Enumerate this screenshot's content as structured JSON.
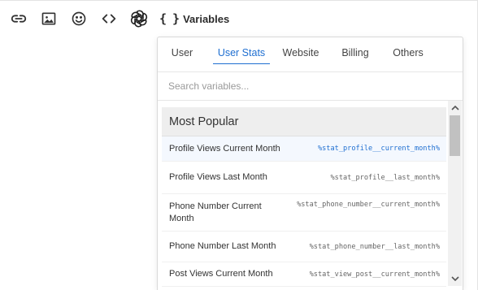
{
  "toolbar": {
    "items": [
      {
        "name": "link",
        "icon": "link-icon"
      },
      {
        "name": "image",
        "icon": "image-icon"
      },
      {
        "name": "emoji",
        "icon": "emoji-icon"
      },
      {
        "name": "code",
        "icon": "code-icon"
      },
      {
        "name": "openai",
        "icon": "openai-icon"
      }
    ],
    "variables_icon": "{ }",
    "variables_label": "Variables"
  },
  "panel": {
    "tabs": [
      {
        "label": "User",
        "active": false
      },
      {
        "label": "User Stats",
        "active": true
      },
      {
        "label": "Website",
        "active": false
      },
      {
        "label": "Billing",
        "active": false
      },
      {
        "label": "Others",
        "active": false
      }
    ],
    "search_placeholder": "Search variables...",
    "section_title": "Most Popular",
    "rows": [
      {
        "label": "Profile Views Current Month",
        "code": "%stat_profile__current_month%",
        "highlighted": true
      },
      {
        "label": "Profile Views Last Month",
        "code": "%stat_profile__last_month%",
        "highlighted": false
      },
      {
        "label": "Phone Number Current Month",
        "code": "%stat_phone_number__current_month%",
        "highlighted": false
      },
      {
        "label": "Phone Number Last Month",
        "code": "%stat_phone_number__last_month%",
        "highlighted": false
      },
      {
        "label": "Post Views Current Month",
        "code": "%stat_view_post__current_month%",
        "highlighted": false
      }
    ]
  },
  "colors": {
    "accent": "#1f6fd1",
    "section_bg": "#eeeeee",
    "highlight_row_bg": "#f4f8fe",
    "scrollbar_thumb": "#c1c1c1"
  }
}
